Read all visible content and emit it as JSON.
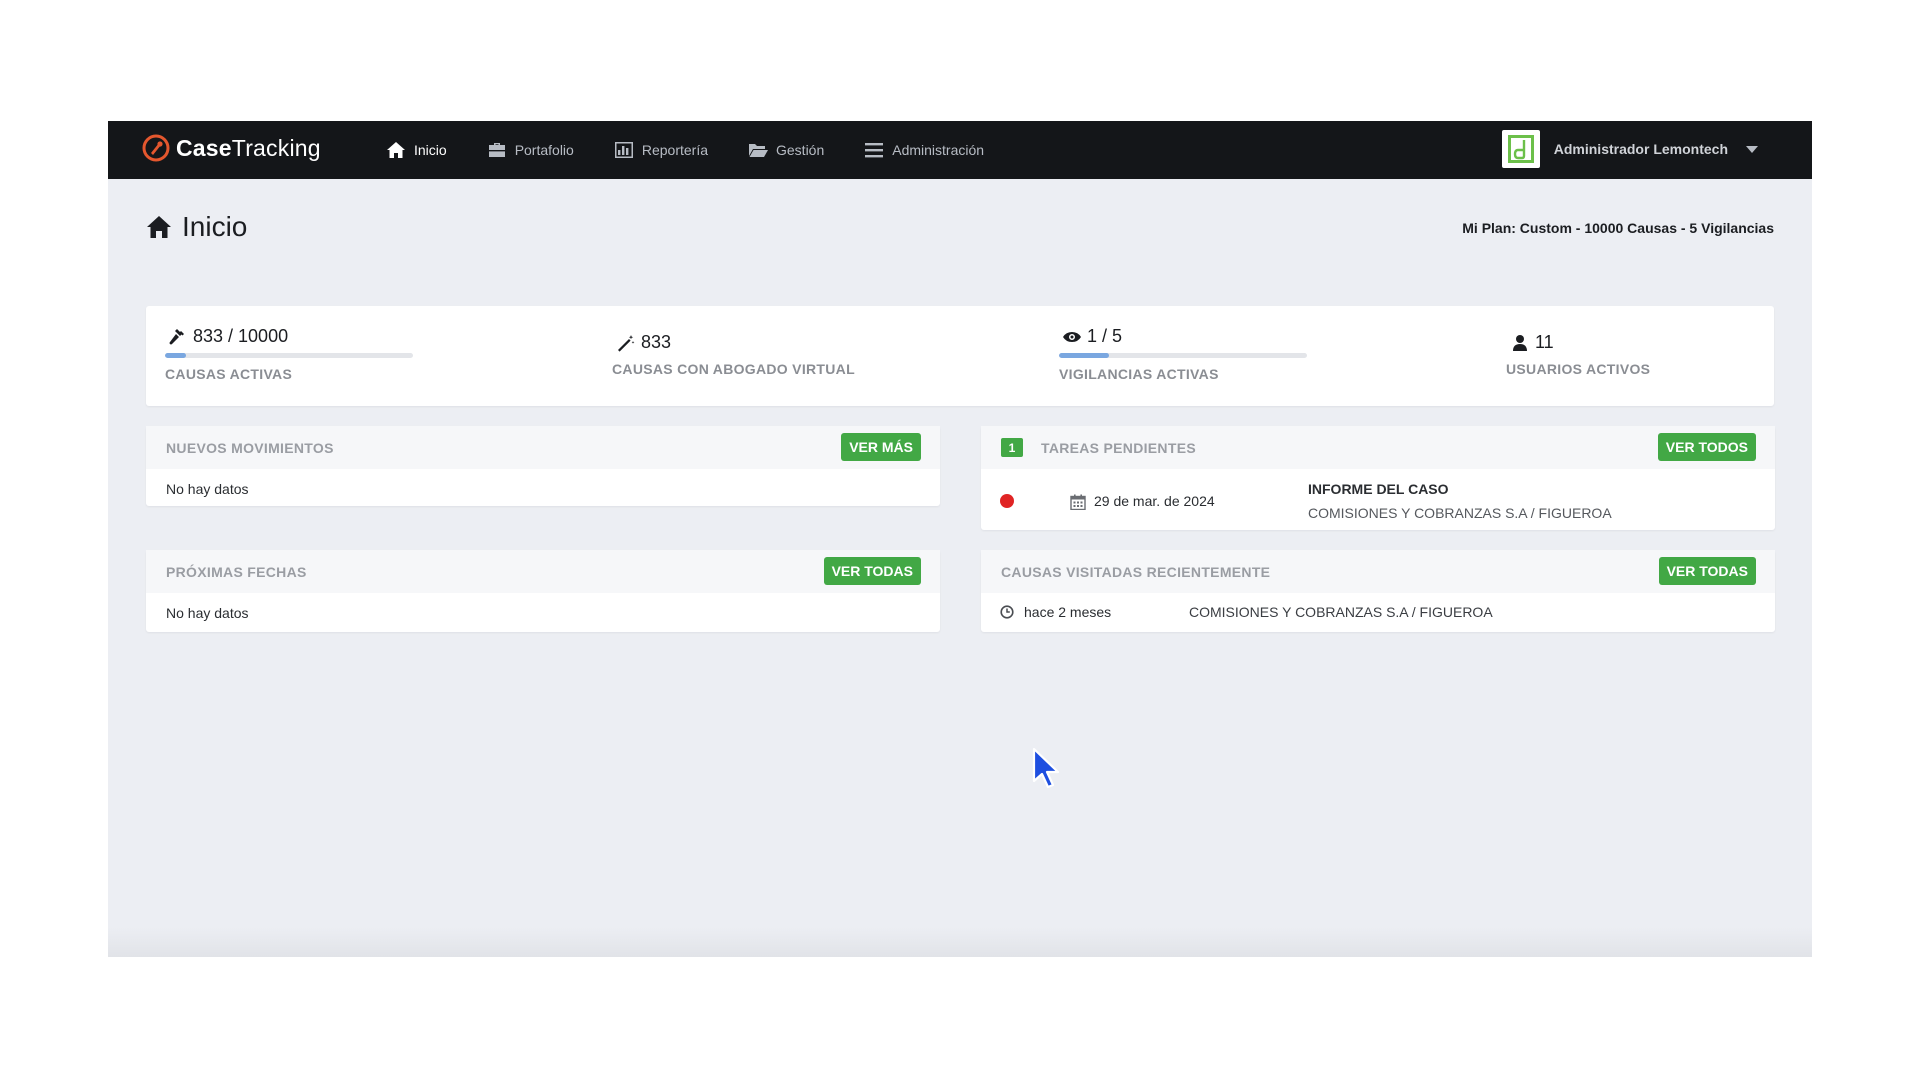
{
  "brand": {
    "name_bold": "Case",
    "name_light": "Tracking",
    "logo": "casetracking-logo-icon",
    "accent": "#e4572e"
  },
  "nav": {
    "items": [
      {
        "label": "Inicio",
        "icon": "home-icon",
        "active": true
      },
      {
        "label": "Portafolio",
        "icon": "briefcase-icon",
        "active": false
      },
      {
        "label": "Reportería",
        "icon": "bar-chart-icon",
        "active": false
      },
      {
        "label": "Gestión",
        "icon": "folder-open-icon",
        "active": false
      },
      {
        "label": "Administración",
        "icon": "menu-icon",
        "active": false
      }
    ],
    "user": {
      "name": "Administrador Lemontech",
      "avatar": "lemontech-logo",
      "caret": "caret-down-icon"
    }
  },
  "page": {
    "title": "Inicio",
    "title_icon": "home-icon",
    "plan": "Mi Plan: Custom - 10000 Causas - 5 Vigilancias"
  },
  "stats": [
    {
      "value": "833 / 10000",
      "label": "CAUSAS ACTIVAS",
      "icon": "gavel-icon",
      "progress": 0.0833
    },
    {
      "value": "833",
      "label": "CAUSAS CON ABOGADO VIRTUAL",
      "icon": "magic-wand-icon"
    },
    {
      "value": "1 / 5",
      "label": "VIGILANCIAS ACTIVAS",
      "icon": "eye-icon",
      "progress": 0.2
    },
    {
      "value": "11",
      "label": "USUARIOS ACTIVOS",
      "icon": "user-icon"
    }
  ],
  "panels": {
    "movimientos": {
      "title": "NUEVOS MOVIMIENTOS",
      "button": "VER MÁS",
      "empty": "No hay datos"
    },
    "fechas": {
      "title": "PRÓXIMAS FECHAS",
      "button": "VER TODAS",
      "empty": "No hay datos"
    },
    "tareas": {
      "title": "TAREAS PENDIENTES",
      "count": "1",
      "button": "VER TODOS",
      "items": [
        {
          "status_color": "#e02424",
          "date": "29 de mar. de 2024",
          "title": "INFORME DEL CASO",
          "subtitle": "COMISIONES Y COBRANZAS S.A / FIGUEROA"
        }
      ]
    },
    "visitadas": {
      "title": "CAUSAS VISITADAS RECIENTEMENTE",
      "button": "VER TODAS",
      "items": [
        {
          "time": "hace 2 meses",
          "case": "COMISIONES Y COBRANZAS S.A / FIGUEROA"
        }
      ]
    }
  },
  "colors": {
    "navbar": "#141619",
    "button_green": "#42a845",
    "progress": "#7aa7e0",
    "background": "#eceef3"
  }
}
